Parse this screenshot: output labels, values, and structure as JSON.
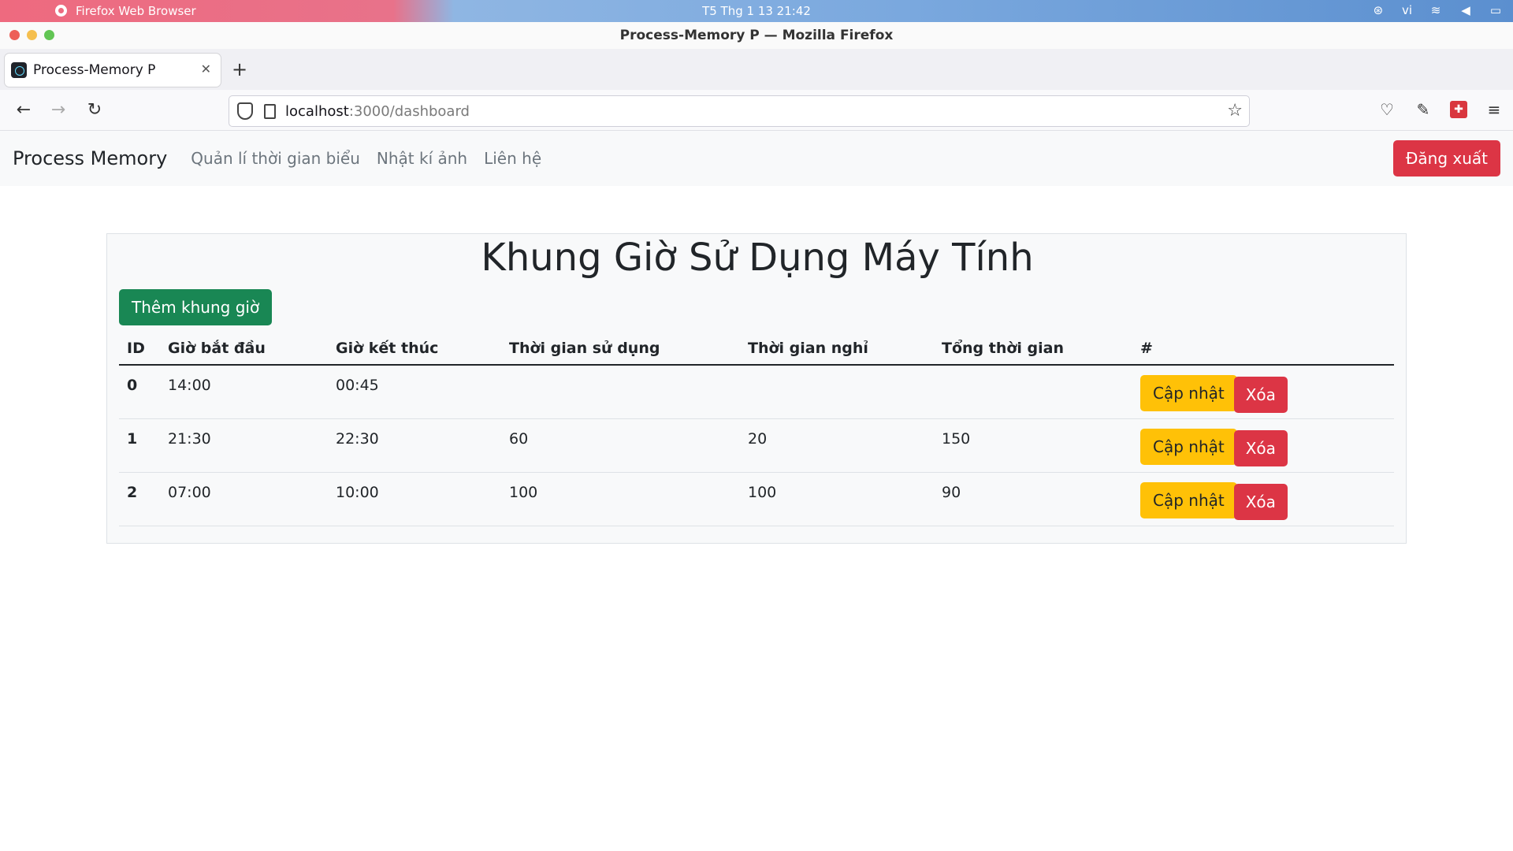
{
  "os_bar": {
    "app_name": "Firefox Web Browser",
    "clock": "T5 Thg 1 13  21:42",
    "lang": "vi"
  },
  "window": {
    "title": "Process-Memory P — Mozilla Firefox"
  },
  "tabs": [
    {
      "label": "Process-Memory P"
    }
  ],
  "urlbar": {
    "host": "localhost",
    "path": ":3000/dashboard"
  },
  "navbar": {
    "brand": "Process Memory",
    "links": [
      "Quản lí thời gian biểu",
      "Nhật kí ảnh",
      "Liên hệ"
    ],
    "logout_label": "Đăng xuất"
  },
  "main": {
    "title": "Khung Giờ Sử Dụng Máy Tính",
    "add_button": "Thêm khung giờ",
    "columns": [
      "ID",
      "Giờ bắt đầu",
      "Giờ kết thúc",
      "Thời gian sử dụng",
      "Thời gian nghỉ",
      "Tổng thời gian",
      "#"
    ],
    "rows": [
      {
        "id": "0",
        "start": "14:00",
        "end": "00:45",
        "use": "",
        "rest": "",
        "total": ""
      },
      {
        "id": "1",
        "start": "21:30",
        "end": "22:30",
        "use": "60",
        "rest": "20",
        "total": "150"
      },
      {
        "id": "2",
        "start": "07:00",
        "end": "10:00",
        "use": "100",
        "rest": "100",
        "total": "90"
      }
    ],
    "update_label": "Cập nhật",
    "delete_label": "Xóa"
  },
  "colors": {
    "danger": "#dc3545",
    "success": "#198754",
    "warning": "#ffc107"
  }
}
